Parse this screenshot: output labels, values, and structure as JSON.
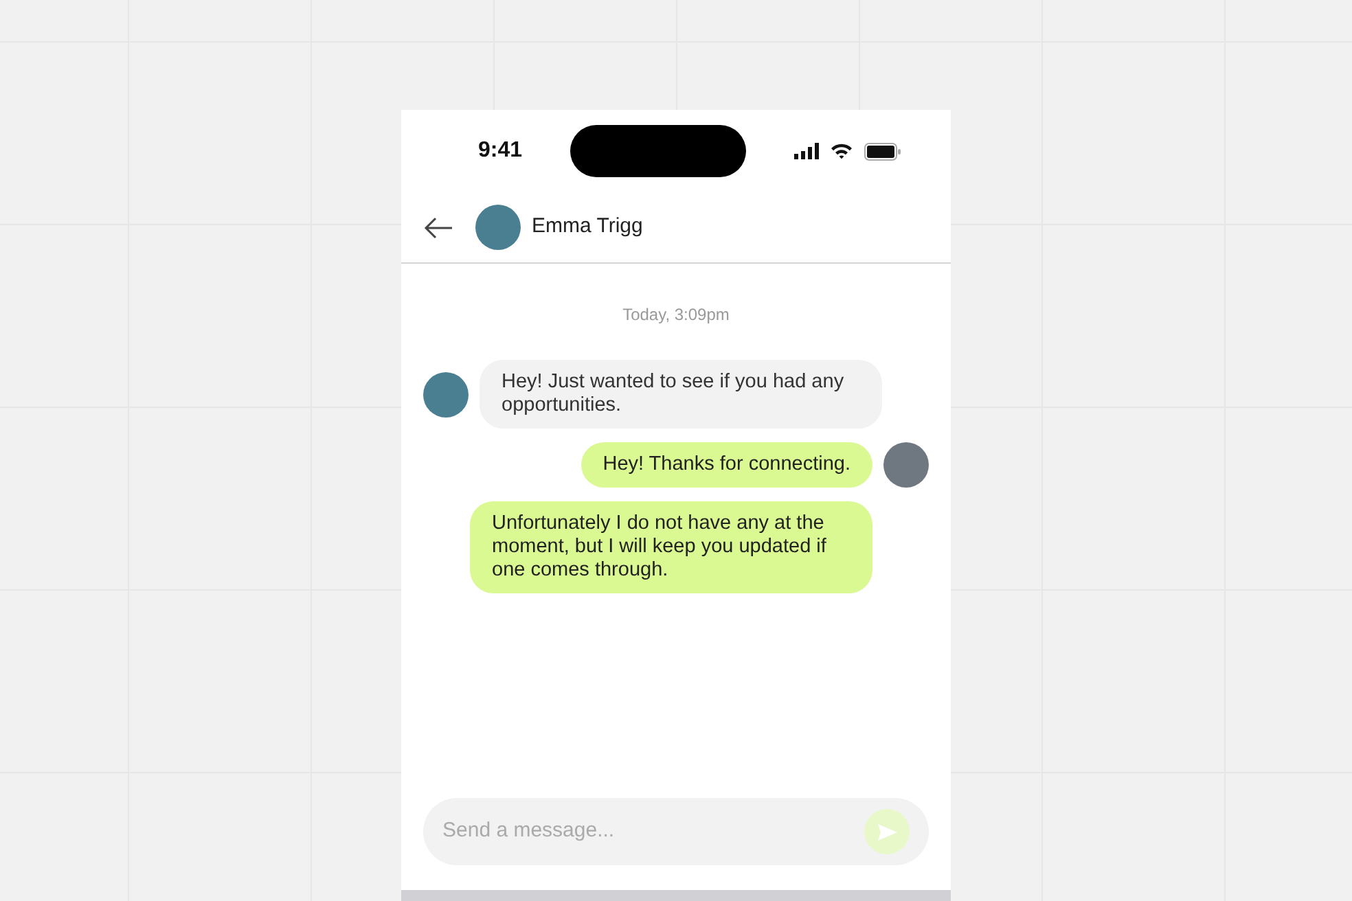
{
  "status_bar": {
    "time": "9:41"
  },
  "header": {
    "contact_name": "Emma Trigg"
  },
  "timestamp": "Today, 3:09pm",
  "messages": [
    {
      "kind": "incoming",
      "avatar": true,
      "text": "Hey! Just wanted to see if you had any opportunities."
    },
    {
      "kind": "outgoing",
      "avatar": true,
      "text": "Hey! Thanks for connecting."
    },
    {
      "kind": "outgoing",
      "avatar": false,
      "text": "Unfortunately I do not have any at the moment, but I will keep you updated if one comes through."
    }
  ],
  "composer": {
    "placeholder": "Send a message...",
    "send_disabled": true
  }
}
